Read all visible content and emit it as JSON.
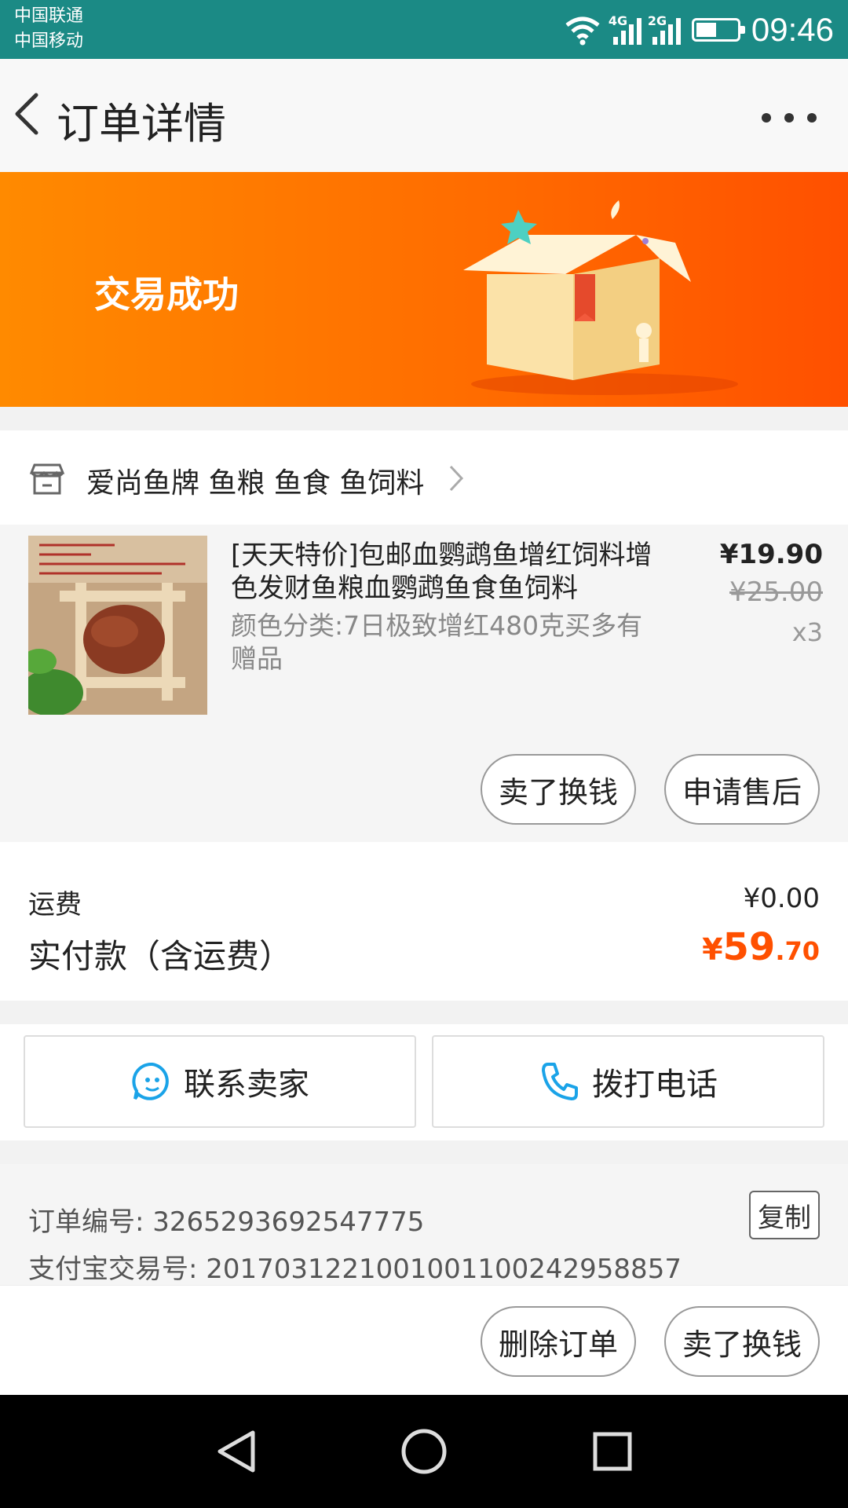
{
  "status_bar": {
    "carrier_1": "中国联通",
    "carrier_2": "中国移动",
    "net_1": "4G",
    "net_2": "2G",
    "time": "09:46"
  },
  "header": {
    "title": "订单详情"
  },
  "banner": {
    "status_text": "交易成功"
  },
  "shop": {
    "name": "爱尚鱼牌 鱼粮 鱼食 鱼饲料"
  },
  "item": {
    "title": "[天天特价]包邮血鹦鹉鱼增红饲料增色发财鱼粮血鹦鹉鱼食鱼饲料",
    "spec": "颜色分类:7日极致增红480克买多有赠品",
    "price": "¥19.90",
    "original_price": "¥25.00",
    "quantity": "x3",
    "actions": [
      "卖了换钱",
      "申请售后"
    ]
  },
  "fees": {
    "shipping_label": "运费",
    "shipping_value": "¥0.00",
    "paid_label": "实付款（含运费）",
    "paid_currency": "¥",
    "paid_int": "59",
    "paid_dec": ".70"
  },
  "contact": {
    "seller_label": "联系卖家",
    "call_label": "拨打电话"
  },
  "order": {
    "number_line": "订单编号: 3265293692547775",
    "alipay_line": "支付宝交易号: 2017031221001001100242958857",
    "copy_label": "复制"
  },
  "bottom_actions": [
    "删除订单",
    "卖了换钱"
  ],
  "colors": {
    "status_bar": "#1b8a85",
    "banner_start": "#ff8a00",
    "banner_end": "#ff5000",
    "accent_price": "#ff5000",
    "icon_blue": "#1aa3e8"
  }
}
